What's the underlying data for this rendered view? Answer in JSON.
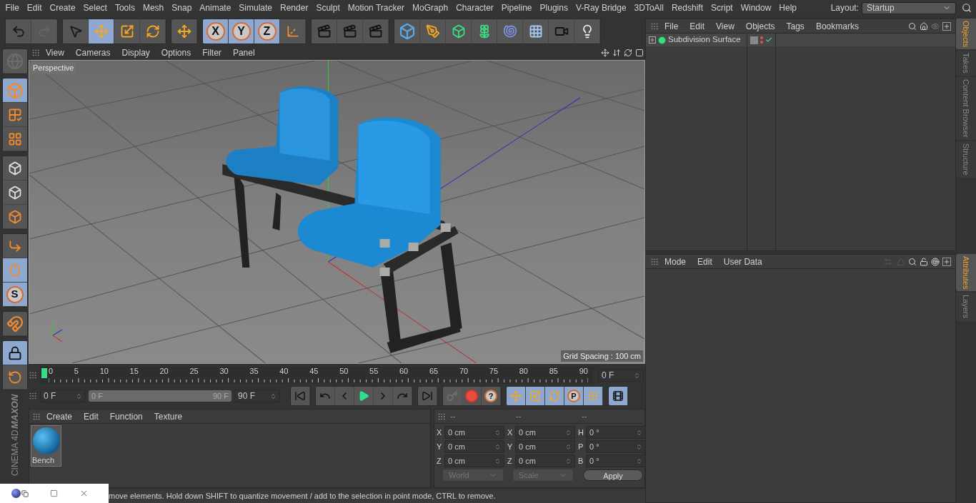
{
  "menu_bar": {
    "items": [
      "File",
      "Edit",
      "Create",
      "Select",
      "Tools",
      "Mesh",
      "Snap",
      "Animate",
      "Simulate",
      "Render",
      "Sculpt",
      "Motion Tracker",
      "MoGraph",
      "Character",
      "Pipeline",
      "Plugins",
      "V-Ray Bridge",
      "3DToAll",
      "Redshift",
      "Script",
      "Window",
      "Help"
    ],
    "layout_label": "Layout:",
    "layout_value": "Startup"
  },
  "toolbar": {
    "groups": [
      [
        {
          "selected": false,
          "disabled": false
        },
        {
          "selected": false,
          "disabled": true
        }
      ],
      [
        {
          "selected": false,
          "disabled": false
        },
        {
          "selected": true,
          "disabled": false
        },
        {
          "selected": false,
          "disabled": false
        },
        {
          "selected": false,
          "disabled": false
        }
      ],
      [
        {
          "selected": false,
          "disabled": false
        }
      ],
      [
        {
          "label": "X",
          "selected": true,
          "disabled": false
        },
        {
          "label": "Y",
          "selected": true,
          "disabled": false
        },
        {
          "label": "Z",
          "selected": true,
          "disabled": false
        },
        {
          "selected": false,
          "disabled": false
        }
      ],
      [
        {
          "selected": false,
          "disabled": false
        },
        {
          "selected": false,
          "disabled": false
        },
        {
          "selected": false,
          "disabled": false
        }
      ],
      [
        {
          "selected": false,
          "disabled": false
        },
        {
          "selected": false,
          "disabled": false
        },
        {
          "selected": false,
          "disabled": false
        },
        {
          "selected": false,
          "disabled": false
        },
        {
          "selected": false,
          "disabled": false
        },
        {
          "selected": false,
          "disabled": false
        },
        {
          "selected": false,
          "disabled": false
        },
        {
          "selected": false,
          "disabled": false
        }
      ]
    ]
  },
  "left_toolbar": {
    "groups": [
      [
        {
          "selected": false,
          "disabled": true
        }
      ],
      [
        {
          "selected": true,
          "disabled": false
        },
        {
          "selected": false,
          "disabled": false
        },
        {
          "selected": false,
          "disabled": false
        }
      ],
      [
        {
          "selected": false,
          "disabled": false
        },
        {
          "selected": false,
          "disabled": false
        },
        {
          "selected": false,
          "disabled": false
        }
      ],
      [
        {
          "selected": false,
          "disabled": false
        },
        {
          "selected": true,
          "disabled": false
        },
        {
          "label": "S",
          "selected": true,
          "disabled": false
        }
      ],
      [
        {
          "selected": false,
          "disabled": false
        }
      ],
      [
        {
          "selected": true,
          "disabled": false
        },
        {
          "selected": false,
          "disabled": false
        }
      ]
    ]
  },
  "logo": {
    "brand": "MAXON",
    "product": "CINEMA 4D"
  },
  "viewport": {
    "menu": [
      "View",
      "Cameras",
      "Display",
      "Options",
      "Filter",
      "Panel"
    ],
    "camera_label": "Perspective",
    "grid_spacing": "Grid Spacing : 100 cm"
  },
  "timeline": {
    "level": 0,
    "ticks": [
      "0",
      "5",
      "10",
      "15",
      "20",
      "25",
      "30",
      "35",
      "40",
      "45",
      "50",
      "55",
      "60",
      "65",
      "70",
      "75",
      "80",
      "85",
      "90"
    ],
    "current_frame": "0 F"
  },
  "playback": {
    "level": 1,
    "start_field": "0 F",
    "range_start": "0 F",
    "range_end": "90 F",
    "end_field": "90 F",
    "groups": [
      [
        {
          "selected": false,
          "disabled": false
        }
      ],
      [
        {
          "selected": false,
          "disabled": false
        },
        {
          "selected": false,
          "disabled": false
        },
        {
          "selected": false,
          "disabled": false
        },
        {
          "selected": false,
          "disabled": false
        },
        {
          "selected": false,
          "disabled": false
        }
      ],
      [
        {
          "selected": false,
          "disabled": false
        }
      ],
      [
        {
          "selected": false,
          "disabled": true
        },
        {
          "selected": false,
          "disabled": false
        },
        {
          "label": "?",
          "selected": false,
          "disabled": false
        }
      ],
      [
        {
          "selected": true,
          "disabled": false
        },
        {
          "selected": true,
          "disabled": false
        },
        {
          "selected": true,
          "disabled": false
        },
        {
          "label": "P",
          "selected": true,
          "disabled": false
        },
        {
          "selected": true,
          "disabled": false
        }
      ],
      [
        {
          "selected": true,
          "disabled": false
        }
      ]
    ]
  },
  "material_manager": {
    "menu": [
      "Create",
      "Edit",
      "Function",
      "Texture"
    ],
    "materials": [
      {
        "name": "Bench"
      }
    ]
  },
  "coordinates": {
    "headers": [
      "--",
      "--",
      "--"
    ],
    "rows": [
      {
        "cells": [
          {
            "label": "X",
            "value": "0 cm"
          },
          {
            "label": "X",
            "value": "0 cm"
          },
          {
            "label": "H",
            "value": "0 °"
          }
        ]
      },
      {
        "cells": [
          {
            "label": "Y",
            "value": "0 cm"
          },
          {
            "label": "Y",
            "value": "0 cm"
          },
          {
            "label": "P",
            "value": "0 °"
          }
        ]
      },
      {
        "cells": [
          {
            "label": "Z",
            "value": "0 cm"
          },
          {
            "label": "Z",
            "value": "0 cm"
          },
          {
            "label": "B",
            "value": "0 °"
          }
        ]
      }
    ],
    "mode_dropdown": "World",
    "size_dropdown": "Scale",
    "apply_button": "Apply"
  },
  "status_bar": {
    "text": "move elements. Hold down SHIFT to quantize movement / add to the selection in point mode, CTRL to remove."
  },
  "object_manager": {
    "menu": [
      "File",
      "Edit",
      "View",
      "Objects",
      "Tags",
      "Bookmarks"
    ],
    "objects": [
      {
        "name": "Subdivision Surface",
        "expanded": false
      }
    ]
  },
  "object_tabs": [
    {
      "label": "Objects",
      "selected": true
    },
    {
      "label": "Takes",
      "selected": false
    },
    {
      "label": "Content Browser",
      "selected": false
    },
    {
      "label": "Structure",
      "selected": false
    }
  ],
  "attribute_manager": {
    "menu": [
      "Mode",
      "Edit",
      "User Data"
    ]
  },
  "attribute_tabs": [
    {
      "label": "Attributes",
      "selected": true
    },
    {
      "label": "Layers",
      "selected": false
    }
  ]
}
